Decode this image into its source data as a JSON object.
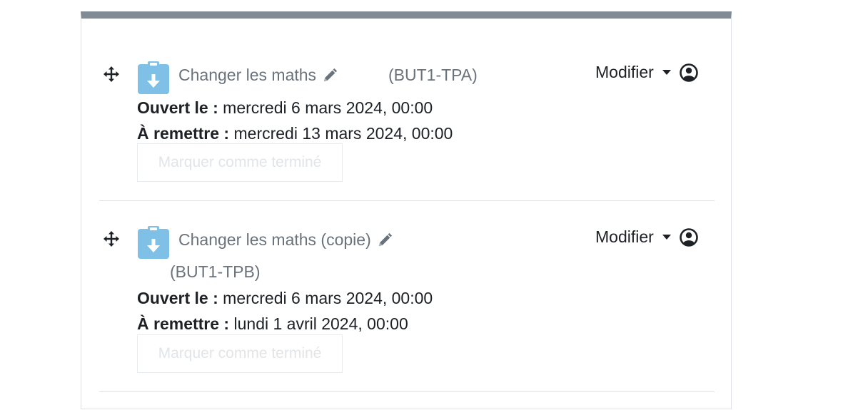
{
  "activities": [
    {
      "title": "Changer les maths",
      "group": "(BUT1-TPA)",
      "opened_label": "Ouvert le :",
      "opened_value": "mercredi 6 mars 2024, 00:00",
      "due_label": "À remettre :",
      "due_value": "mercredi 13 mars 2024, 00:00",
      "complete_button": "Marquer comme terminé",
      "edit_menu": "Modifier"
    },
    {
      "title": "Changer les maths (copie)",
      "group": "(BUT1-TPB)",
      "opened_label": "Ouvert le :",
      "opened_value": "mercredi 6 mars 2024, 00:00",
      "due_label": "À remettre :",
      "due_value": "lundi 1 avril 2024, 00:00",
      "complete_button": "Marquer comme terminé",
      "edit_menu": "Modifier"
    }
  ],
  "icons": {
    "move": "move-arrows-icon",
    "activity": "assignment-download-icon",
    "edit": "pencil-icon",
    "menu": "caret-down-icon",
    "user": "user-circle-icon"
  },
  "colors": {
    "section_bar": "#818b96",
    "activity_icon": "#7fc0e6",
    "muted_text": "#6a737b",
    "text": "#1d2125"
  }
}
